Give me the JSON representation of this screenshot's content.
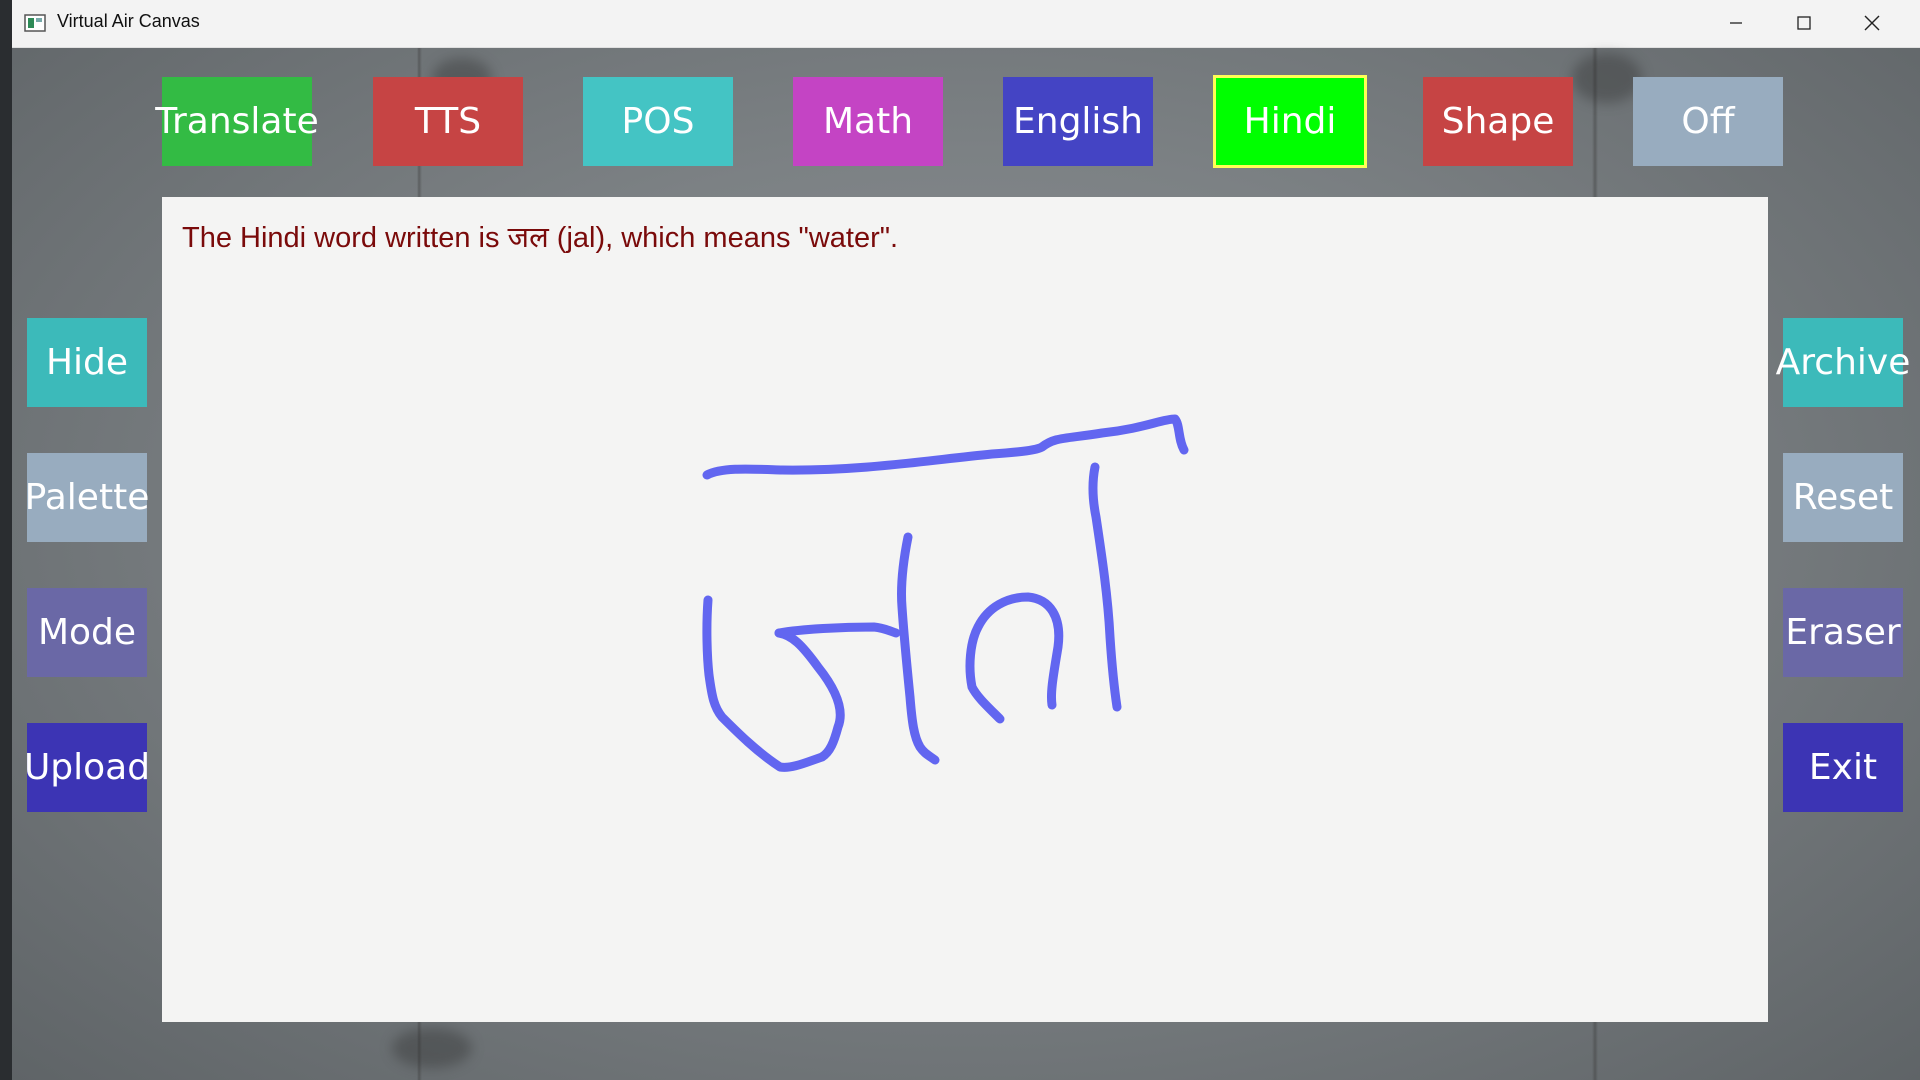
{
  "window": {
    "title": "Virtual Air Canvas"
  },
  "top_bar": [
    {
      "label": "Translate",
      "color": "#33bb44"
    },
    {
      "label": "TTS",
      "color": "#c64444"
    },
    {
      "label": "POS",
      "color": "#44c4c4"
    },
    {
      "label": "Math",
      "color": "#c444c4"
    },
    {
      "label": "English",
      "color": "#4444c4"
    },
    {
      "label": "Hindi",
      "color": "#00ff00",
      "selected": true,
      "border": "#ffff55"
    },
    {
      "label": "Shape",
      "color": "#c64444"
    },
    {
      "label": "Off",
      "color": "#98acbf"
    }
  ],
  "left_bar": [
    {
      "label": "Hide",
      "color": "#3cbaba"
    },
    {
      "label": "Palette",
      "color": "#98acbf"
    },
    {
      "label": "Mode",
      "color": "#6a68a6"
    },
    {
      "label": "Upload",
      "color": "#3c34b4"
    }
  ],
  "right_bar": [
    {
      "label": "Archive",
      "color": "#3cbaba"
    },
    {
      "label": "Reset",
      "color": "#98acbf"
    },
    {
      "label": "Eraser",
      "color": "#6a68a6"
    },
    {
      "label": "Exit",
      "color": "#3c34b4"
    }
  ],
  "canvas": {
    "result_text": "The Hindi word written is जल (jal), which means \"water\".",
    "stroke_color": "#6266f0"
  }
}
